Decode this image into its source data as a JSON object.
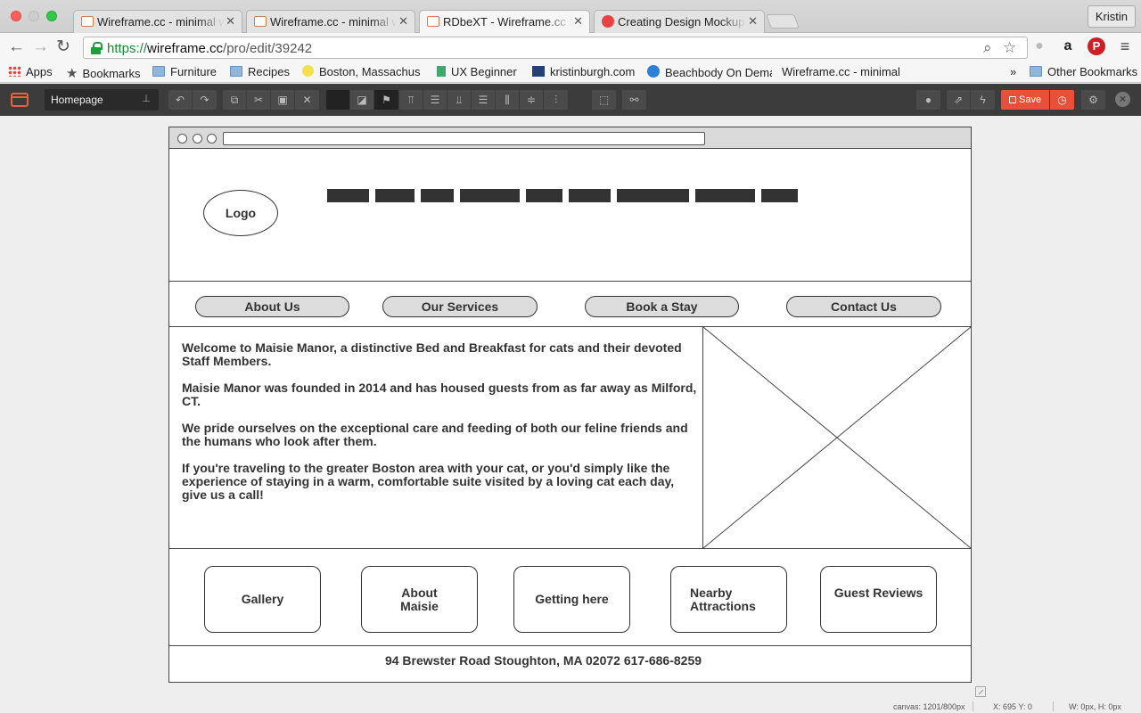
{
  "browser": {
    "tabs": [
      {
        "title": "Wireframe.cc - minimal wireframing tool",
        "favicon": "wireframe-favicon",
        "active": false
      },
      {
        "title": "Wireframe.cc - minimal wireframing tool",
        "favicon": "wireframe-favicon",
        "active": false
      },
      {
        "title": "RDbeXT - Wireframe.cc Pro",
        "favicon": "wireframe-favicon",
        "active": true
      },
      {
        "title": "Creating Design Mockups |",
        "favicon": "red-circle-favicon",
        "active": false
      }
    ],
    "profile_name": "Kristin",
    "url": {
      "scheme": "https://",
      "host": "wireframe.cc",
      "path": "/pro/edit/39242"
    },
    "bookmarks": [
      {
        "label": "Apps",
        "icon": "apps-grid-icon"
      },
      {
        "label": "Bookmarks",
        "icon": "star-icon"
      },
      {
        "label": "Furniture",
        "icon": "folder-icon"
      },
      {
        "label": "Recipes",
        "icon": "folder-icon"
      },
      {
        "label": "Boston, Massachusetts",
        "icon": "smiley-icon"
      },
      {
        "label": "UX Beginner",
        "icon": "book-icon"
      },
      {
        "label": "kristinburgh.com",
        "icon": "grid-icon"
      },
      {
        "label": "Beachbody On Demand",
        "icon": "globe-icon"
      },
      {
        "label": "Wireframe.cc - minimal",
        "icon": "wireframe-favicon"
      }
    ],
    "bookmarks_overflow": "»",
    "other_bookmarks": "Other Bookmarks"
  },
  "toolbar": {
    "page_name": "Homepage",
    "save_label": "Save"
  },
  "wireframe": {
    "logo_label": "Logo",
    "nav_pills": [
      "About Us",
      "Our Services",
      "Book a Stay",
      "Contact Us"
    ],
    "paragraphs": [
      "Welcome to Maisie Manor, a distinctive Bed and Breakfast for cats and their devoted Staff Members.",
      "Maisie Manor was founded in 2014 and has housed guests from as far away as Milford, CT.",
      "We pride ourselves on the exceptional care and feeding of both our feline friends and the humans who look after them.",
      "If you're traveling to the greater Boston area with your cat, or you'd simply like the experience of staying in a warm, comfortable suite visited by a loving cat each day, give us a call!"
    ],
    "boxes": [
      "Gallery",
      "About Maisie",
      "Getting here",
      "Nearby Attractions",
      "Guest Reviews"
    ],
    "footer": "94 Brewster Road Stoughton, MA 02072 617-686-8259"
  },
  "status": {
    "canvas": "canvas: 1201/800px",
    "coords": "X: 695 Y: 0",
    "size": "W: 0px, H: 0px"
  },
  "colors": {
    "accent": "#e8503a",
    "toolbar_bg": "#3c3c3c",
    "wireframe_stroke": "#333333"
  }
}
